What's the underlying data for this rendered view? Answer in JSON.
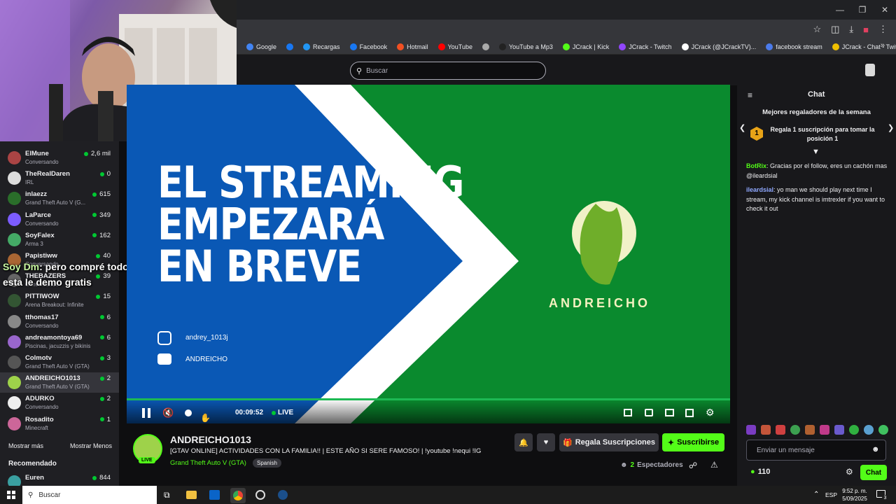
{
  "browser": {
    "bookmarks": [
      {
        "label": "Google",
        "color": "#4285f4"
      },
      {
        "label": "",
        "color": "#1877f2"
      },
      {
        "label": "Recargas",
        "color": "#2196f3"
      },
      {
        "label": "Facebook",
        "color": "#1877f2"
      },
      {
        "label": "Hotmail",
        "color": "#f25022"
      },
      {
        "label": "YouTube",
        "color": "#ff0000"
      },
      {
        "label": "",
        "color": "#aaaaaa"
      },
      {
        "label": "YouTube a Mp3",
        "color": "#222222"
      },
      {
        "label": "JCrack | Kick",
        "color": "#53fc18"
      },
      {
        "label": "JCrack - Twitch",
        "color": "#9146ff"
      },
      {
        "label": "JCrack (@JCrackTV)...",
        "color": "#ffffff"
      },
      {
        "label": "facebook stream",
        "color": "#4b7bec"
      },
      {
        "label": "JCrack - Chat - Twitch",
        "color": "#f0c000"
      }
    ]
  },
  "topbar": {
    "search_placeholder": "Buscar"
  },
  "sidebar": {
    "channels": [
      {
        "name": "ElMune",
        "game": "Conversando",
        "viewers": "2,6 mil",
        "color": "#aa4444"
      },
      {
        "name": "TheRealDaren",
        "game": "IRL",
        "viewers": "0",
        "color": "#dddddd"
      },
      {
        "name": "inlaezz",
        "game": "Grand Theft Auto V (G...",
        "viewers": "615",
        "color": "#2a6e2a"
      },
      {
        "name": "LaParce",
        "game": "Conversando",
        "viewers": "349",
        "color": "#7c5cff"
      },
      {
        "name": "SoyFalex",
        "game": "Arma 3",
        "viewers": "162",
        "color": "#44aa66"
      },
      {
        "name": "Papistiww",
        "game": "Conversando",
        "viewers": "40",
        "color": "#aa6633"
      },
      {
        "name": "THEBAZERS",
        "game": "Conversando",
        "viewers": "39",
        "color": "#666666"
      },
      {
        "name": "PITTIWOW",
        "game": "Arena Breakout: Infinite",
        "viewers": "15",
        "color": "#335533"
      },
      {
        "name": "tthomas17",
        "game": "Conversando",
        "viewers": "6",
        "color": "#888888"
      },
      {
        "name": "andreamontoya69",
        "game": "Piscinas, jacuzzis y bikinis",
        "viewers": "6",
        "color": "#9966cc"
      },
      {
        "name": "Colmotv",
        "game": "Grand Theft Auto V (GTA)",
        "viewers": "3",
        "color": "#555555"
      },
      {
        "name": "ANDREICHO1013",
        "game": "Grand Theft Auto V (GTA)",
        "viewers": "2",
        "color": "#9ed24a"
      },
      {
        "name": "ADURKO",
        "game": "Conversando",
        "viewers": "2",
        "color": "#eeeeee"
      },
      {
        "name": "Rosadito",
        "game": "Minecraft",
        "viewers": "1",
        "color": "#cc6699"
      }
    ],
    "show_more": "Mostrar más",
    "show_less": "Mostrar Menos",
    "recommended_title": "Recomendado",
    "recommended": {
      "name": "Euren",
      "viewers": "844"
    }
  },
  "overlay": {
    "user": "Soy Dm",
    "message": ": pero compré todo por qué",
    "message2": "esta le demo gratis"
  },
  "video": {
    "line1": "EL STREAMING",
    "line2": "EMPEZARÁ",
    "line3": "EN BREVE",
    "instagram": "andrey_1013j",
    "youtube": "ANDREICHO",
    "logo_text": "ANDREICHO",
    "time": "00:09:52",
    "live": "LIVE",
    "progress": 1.0
  },
  "stream": {
    "channel": "ANDREICHO1013",
    "live_badge": "LIVE",
    "title": "[GTAV ONLINE] ACTIVIDADES CON LA FAMILIA!! | ESTE AÑO SI SERE FAMOSO! | !youtube !nequi !IG",
    "game": "Grand Theft Auto V (GTA)",
    "language": "Spanish",
    "gift_label": "Regala Suscripciones",
    "subscribe_label": "Suscribirse",
    "viewers_count": "2",
    "viewers_label": "Espectadores"
  },
  "chat": {
    "title": "Chat",
    "leaderboard_title": "Mejores regaladores de la semana",
    "leaderboard_rank": "1",
    "leaderboard_text": "Regala 1 suscripción para tomar la posición 1",
    "messages": [
      {
        "user": "BotRix",
        "user_color": "#53fc18",
        "text": "Gracias por el follow, eres un cachón mas @ileardsial"
      },
      {
        "user": "ileardsial",
        "user_color": "#8fa8ff",
        "text": "yo man we should play next time I stream, my kick channel is imtrexler if you want to check it out"
      }
    ],
    "input_placeholder": "Enviar un mensaje",
    "points": "110",
    "send_label": "Chat"
  },
  "taskbar": {
    "search_placeholder": "Buscar",
    "lang": "ESP",
    "time": "9:52 p. m.",
    "date": "5/09/2025",
    "notif_count": "3"
  }
}
